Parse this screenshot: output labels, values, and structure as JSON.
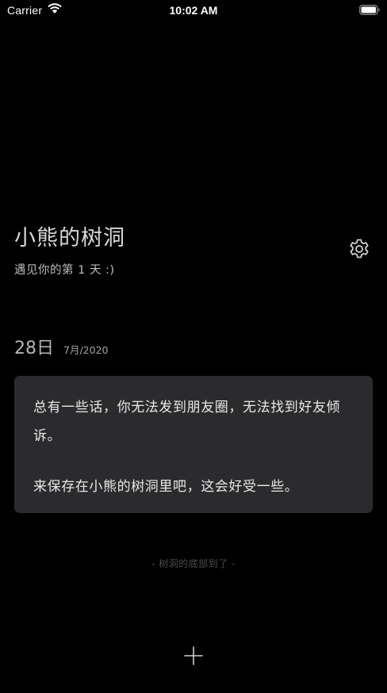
{
  "status_bar": {
    "carrier": "Carrier",
    "time": "10:02 AM",
    "icons": [
      "wifi-icon",
      "battery-icon"
    ]
  },
  "header": {
    "title": "小熊的树洞",
    "subtitle": "遇见你的第 1 天 :)",
    "settings_icon": "gear-icon"
  },
  "entry": {
    "day": "28日",
    "month_year": "7月/2020",
    "paragraphs": [
      "总有一些话，你无法发到朋友圈，无法找到好友倾诉。",
      "来保存在小熊的树洞里吧，这会好受一些。"
    ]
  },
  "footer": {
    "note": "- 树洞的底部到了 -",
    "add_icon": "plus-icon"
  },
  "colors": {
    "background": "#000000",
    "card": "#2b2b2d",
    "text": "#e6e6e6"
  }
}
